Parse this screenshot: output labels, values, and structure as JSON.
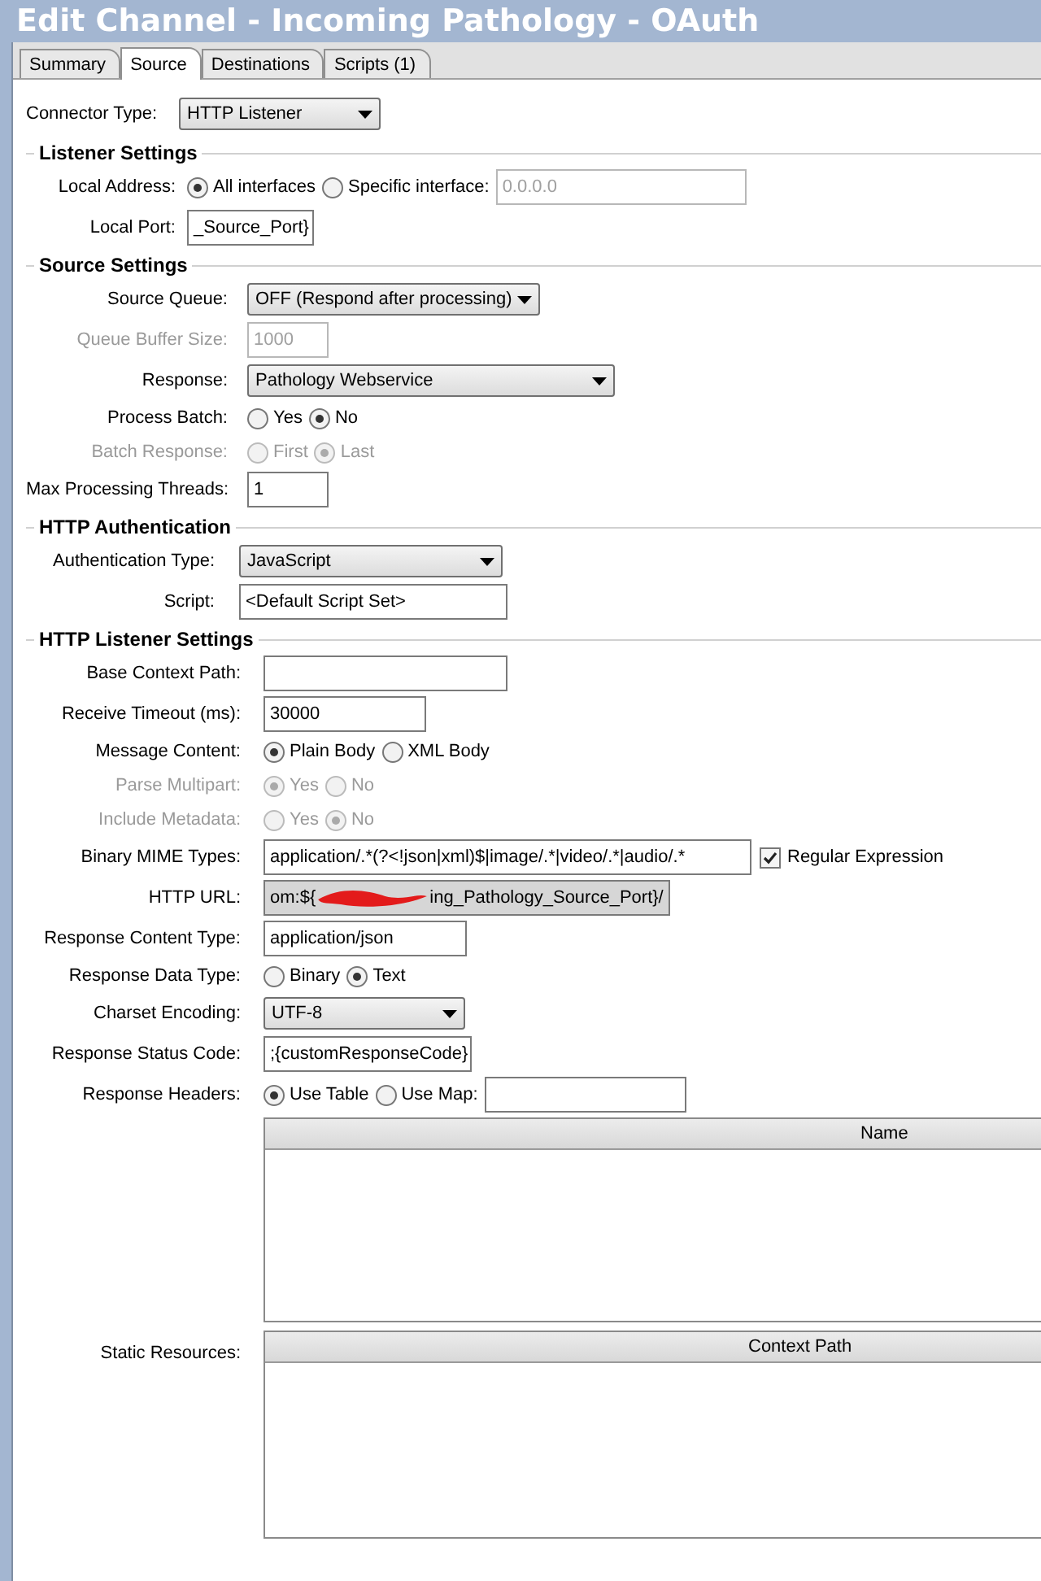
{
  "window": {
    "title": "Edit Channel - Incoming Pathology - OAuth"
  },
  "tabs": [
    {
      "label": "Summary",
      "selected": false
    },
    {
      "label": "Source",
      "selected": true
    },
    {
      "label": "Destinations",
      "selected": false
    },
    {
      "label": "Scripts (1)",
      "selected": false
    }
  ],
  "connector": {
    "label": "Connector Type:",
    "value": "HTTP Listener"
  },
  "sections": [
    {
      "title": "Listener Settings",
      "rows": [
        {
          "kind": "radio",
          "label": "Local Address:",
          "disabled": false,
          "options": [
            {
              "label": "All interfaces",
              "selected": true
            },
            {
              "label": "Specific interface:",
              "selected": false
            }
          ],
          "field": {
            "value": "0.0.0.0",
            "disabled": true
          }
        },
        {
          "kind": "input",
          "label": "Local Port:",
          "disabled": false,
          "value": "_Source_Port}"
        }
      ]
    },
    {
      "title": "Source Settings",
      "rows": [
        {
          "kind": "select",
          "label": "Source Queue:",
          "disabled": false,
          "value": "OFF (Respond after processing)"
        },
        {
          "kind": "input",
          "label": "Queue Buffer Size:",
          "disabled": true,
          "value": "1000"
        },
        {
          "kind": "select",
          "label": "Response:",
          "disabled": false,
          "value": "Pathology Webservice"
        },
        {
          "kind": "radio",
          "label": "Process Batch:",
          "disabled": false,
          "options": [
            {
              "label": "Yes",
              "selected": false
            },
            {
              "label": "No",
              "selected": true
            }
          ]
        },
        {
          "kind": "radio",
          "label": "Batch Response:",
          "disabled": true,
          "options": [
            {
              "label": "First",
              "selected": false
            },
            {
              "label": "Last",
              "selected": true
            }
          ]
        },
        {
          "kind": "input",
          "label": "Max Processing Threads:",
          "disabled": false,
          "value": "1"
        }
      ]
    },
    {
      "title": "HTTP Authentication",
      "rows": [
        {
          "kind": "select",
          "label": "Authentication Type:",
          "disabled": false,
          "value": "JavaScript"
        },
        {
          "kind": "input",
          "label": "Script:",
          "disabled": false,
          "value": "<Default Script Set>"
        }
      ]
    },
    {
      "title": "HTTP Listener Settings",
      "rows": [
        {
          "kind": "input",
          "label": "Base Context Path:",
          "disabled": false,
          "value": ""
        },
        {
          "kind": "input",
          "label": "Receive Timeout (ms):",
          "disabled": false,
          "value": "30000"
        },
        {
          "kind": "radio",
          "label": "Message Content:",
          "disabled": false,
          "options": [
            {
              "label": "Plain Body",
              "selected": true
            },
            {
              "label": "XML Body",
              "selected": false
            }
          ]
        },
        {
          "kind": "radio",
          "label": "Parse Multipart:",
          "disabled": true,
          "options": [
            {
              "label": "Yes",
              "selected": true
            },
            {
              "label": "No",
              "selected": false
            }
          ]
        },
        {
          "kind": "radio",
          "label": "Include Metadata:",
          "disabled": true,
          "options": [
            {
              "label": "Yes",
              "selected": false
            },
            {
              "label": "No",
              "selected": true
            }
          ]
        },
        {
          "kind": "input",
          "label": "Binary MIME Types:",
          "disabled": false,
          "value": "application/.*(?<!json|xml)$|image/.*|video/.*|audio/.*",
          "checkbox": {
            "label": "Regular Expression",
            "checked": true
          }
        },
        {
          "kind": "url",
          "label": "HTTP URL:",
          "disabled": false,
          "before": "om:${",
          "after": "ing_Pathology_Source_Port}/"
        },
        {
          "kind": "input",
          "label": "Response Content Type:",
          "disabled": false,
          "value": "application/json"
        },
        {
          "kind": "radio",
          "label": "Response Data Type:",
          "disabled": false,
          "options": [
            {
              "label": "Binary",
              "selected": false
            },
            {
              "label": "Text",
              "selected": true
            }
          ]
        },
        {
          "kind": "select",
          "label": "Charset Encoding:",
          "disabled": false,
          "value": "UTF-8"
        },
        {
          "kind": "input",
          "label": "Response Status Code:",
          "disabled": false,
          "value": ";{customResponseCode}"
        },
        {
          "kind": "radio",
          "label": "Response Headers:",
          "disabled": false,
          "options": [
            {
              "label": "Use Table",
              "selected": true
            },
            {
              "label": "Use Map:",
              "selected": false
            }
          ],
          "field": {
            "disabled": false
          }
        },
        {
          "kind": "table",
          "label": "",
          "header": "Name"
        },
        {
          "kind": "table",
          "label": "Static Resources:",
          "header": "Context Path"
        }
      ]
    }
  ]
}
